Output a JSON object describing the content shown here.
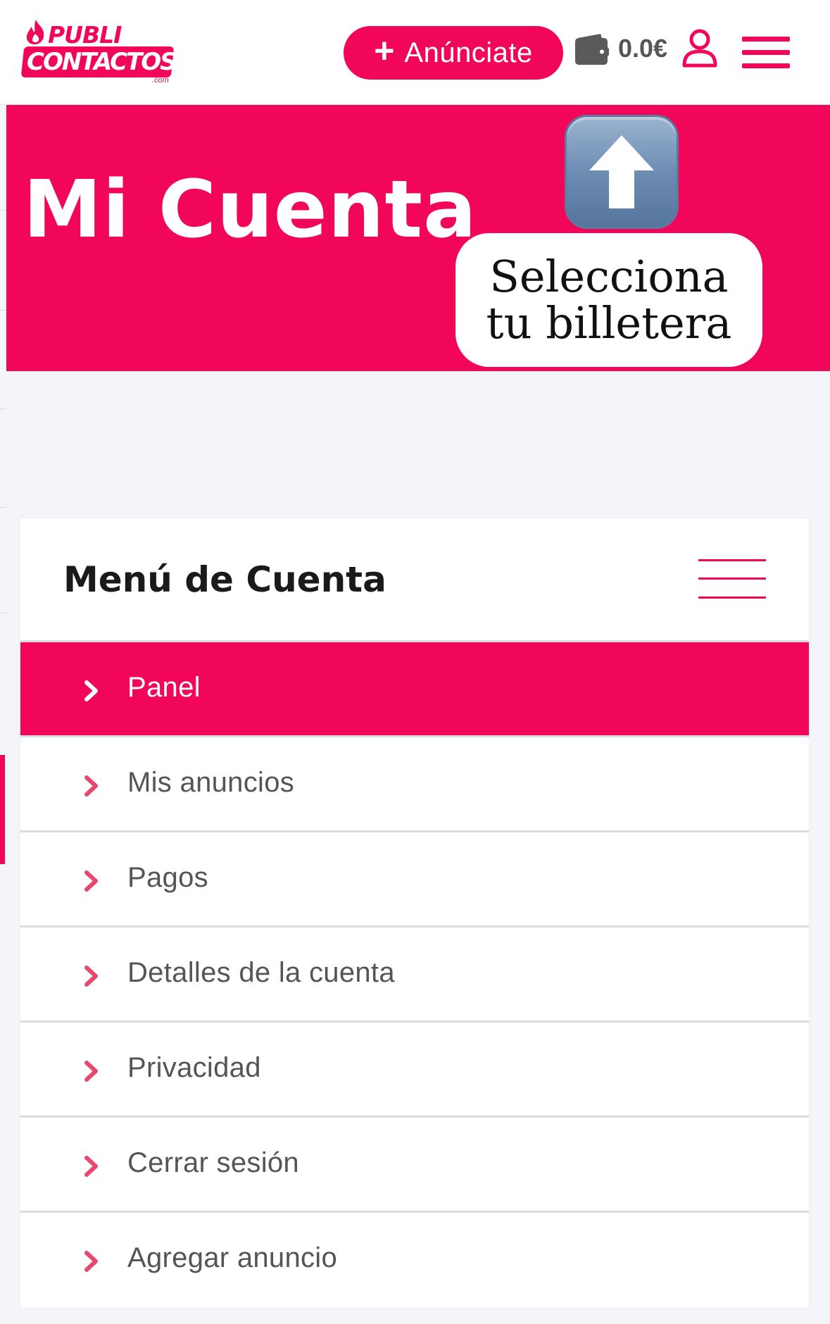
{
  "header": {
    "logo_top": "PUBLI",
    "logo_bottom": "CONTACTOS",
    "logo_suffix": ".com",
    "announce_plus": "+",
    "announce_label": "Anúnciate",
    "wallet_icon": "wallet-icon",
    "balance": "0.0€",
    "user_icon": "user-icon",
    "menu_icon": "hamburger-menu-icon"
  },
  "hero": {
    "title": "Mi Cuenta",
    "arrow_icon": "up-arrow-emoji-icon",
    "tooltip_line1": "Selecciona",
    "tooltip_line2": "tu billetera"
  },
  "account_menu": {
    "title": "Menú de Cuenta",
    "toggle_icon": "menu-toggle-icon",
    "items": [
      {
        "label": "Panel",
        "active": true
      },
      {
        "label": "Mis anuncios",
        "active": false
      },
      {
        "label": "Pagos",
        "active": false
      },
      {
        "label": "Detalles de la cuenta",
        "active": false
      },
      {
        "label": "Privacidad",
        "active": false
      },
      {
        "label": "Cerrar sesión",
        "active": false
      },
      {
        "label": "Agregar anuncio",
        "active": false
      }
    ]
  },
  "colors": {
    "brand": "#f2065a",
    "page_bg": "#f4f5f9",
    "text_muted": "#555555",
    "text_dark": "#1a1a1a"
  }
}
